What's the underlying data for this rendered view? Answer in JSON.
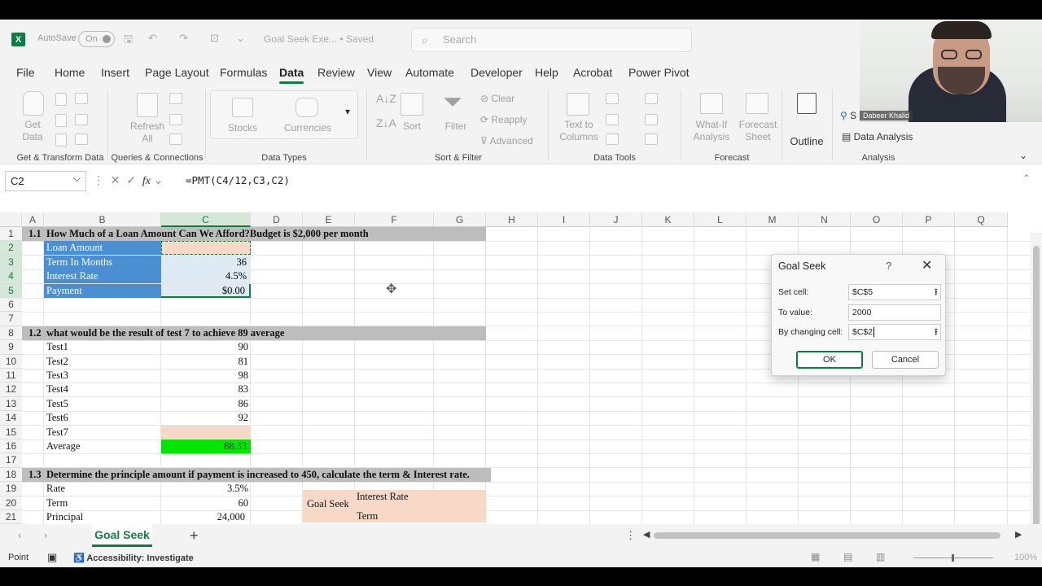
{
  "titlebar": {
    "autosave_label": "AutoSave",
    "autosave_state": "On",
    "document_name": "Goal Seek Exe... • Saved",
    "search_placeholder": "Search"
  },
  "menu": [
    "File",
    "Home",
    "Insert",
    "Page Layout",
    "Formulas",
    "Data",
    "Review",
    "View",
    "Automate",
    "Developer",
    "Help",
    "Acrobat",
    "Power Pivot"
  ],
  "active_menu": "Data",
  "ribbon": {
    "get_data": "Get Data",
    "refresh_all": "Refresh All",
    "stocks": "Stocks",
    "currencies": "Currencies",
    "sort": "Sort",
    "filter": "Filter",
    "clear": "Clear",
    "reapply": "Reapply",
    "advanced": "Advanced",
    "text_to_columns": "Text to Columns",
    "what_if": "What-If Analysis",
    "forecast_sheet": "Forecast Sheet",
    "outline": "Outline",
    "solver": "S",
    "data_analysis": "Data Analysis",
    "groups": {
      "get_transform": "Get & Transform Data",
      "queries": "Queries & Connections",
      "data_types": "Data Types",
      "sort_filter": "Sort & Filter",
      "data_tools": "Data Tools",
      "forecast": "Forecast",
      "analysis": "Analysis"
    }
  },
  "formula_bar": {
    "name_box": "C2",
    "formula": "=PMT(C4/12,C3,C2)"
  },
  "columns": [
    "A",
    "B",
    "C",
    "D",
    "E",
    "F",
    "G",
    "H",
    "I",
    "J",
    "K",
    "L",
    "M",
    "N",
    "O",
    "P",
    "Q"
  ],
  "rows": [
    "1",
    "2",
    "3",
    "4",
    "5",
    "6",
    "7",
    "8",
    "9",
    "10",
    "11",
    "12",
    "13",
    "14",
    "15",
    "16",
    "17",
    "18",
    "19",
    "20",
    "21"
  ],
  "sheet": {
    "s1_num": "1.1",
    "s1_title": "How Much of a Loan Amount Can We Afford?Budget is $2,000 per month",
    "loan_amount": "Loan Amount",
    "term_months": "Term In Months",
    "term_value": "36",
    "interest_rate": "Interest Rate",
    "interest_value": "4.5%",
    "payment": "Payment",
    "payment_value": "$0.00",
    "s2_num": "1.2",
    "s2_title": "what would be the result of test 7 to achieve 89 average",
    "tests": [
      {
        "name": "Test1",
        "value": "90"
      },
      {
        "name": "Test2",
        "value": "81"
      },
      {
        "name": "Test3",
        "value": "98"
      },
      {
        "name": "Test4",
        "value": "83"
      },
      {
        "name": "Test5",
        "value": "86"
      },
      {
        "name": "Test6",
        "value": "92"
      },
      {
        "name": "Test7",
        "value": ""
      }
    ],
    "average": "Average",
    "average_value": "88.33",
    "s3_num": "1.3",
    "s3_title": "Determine the principle amount if payment is increased to 450, calculate the term & Interest rate.",
    "rate": "Rate",
    "rate_value": "3.5%",
    "term": "Term",
    "term2_value": "60",
    "principal": "Principal",
    "principal_value": "24,000",
    "goal_seek_label": "Goal Seek",
    "gs_interest": "Interest Rate",
    "gs_term": "Term"
  },
  "dialog": {
    "title": "Goal Seek",
    "help": "?",
    "set_cell_label": "Set cell:",
    "set_cell_value": "$C$5",
    "to_value_label": "To value:",
    "to_value_value": "2000",
    "changing_label": "By changing cell:",
    "changing_value": "$C$2",
    "ok": "OK",
    "cancel": "Cancel"
  },
  "sheet_tab": "Goal Seek",
  "status": {
    "mode": "Point",
    "accessibility": "Accessibility: Investigate",
    "zoom": "100%"
  },
  "webcam": {
    "name": "Dabeer Khalid"
  },
  "colors": {
    "excel_green": "#107c41",
    "header_blue": "#4a8fd1",
    "light_blue": "#deebf5",
    "peach": "#f8d9c8",
    "bright_green": "#00e600",
    "band_gray": "#bdbdbd"
  }
}
